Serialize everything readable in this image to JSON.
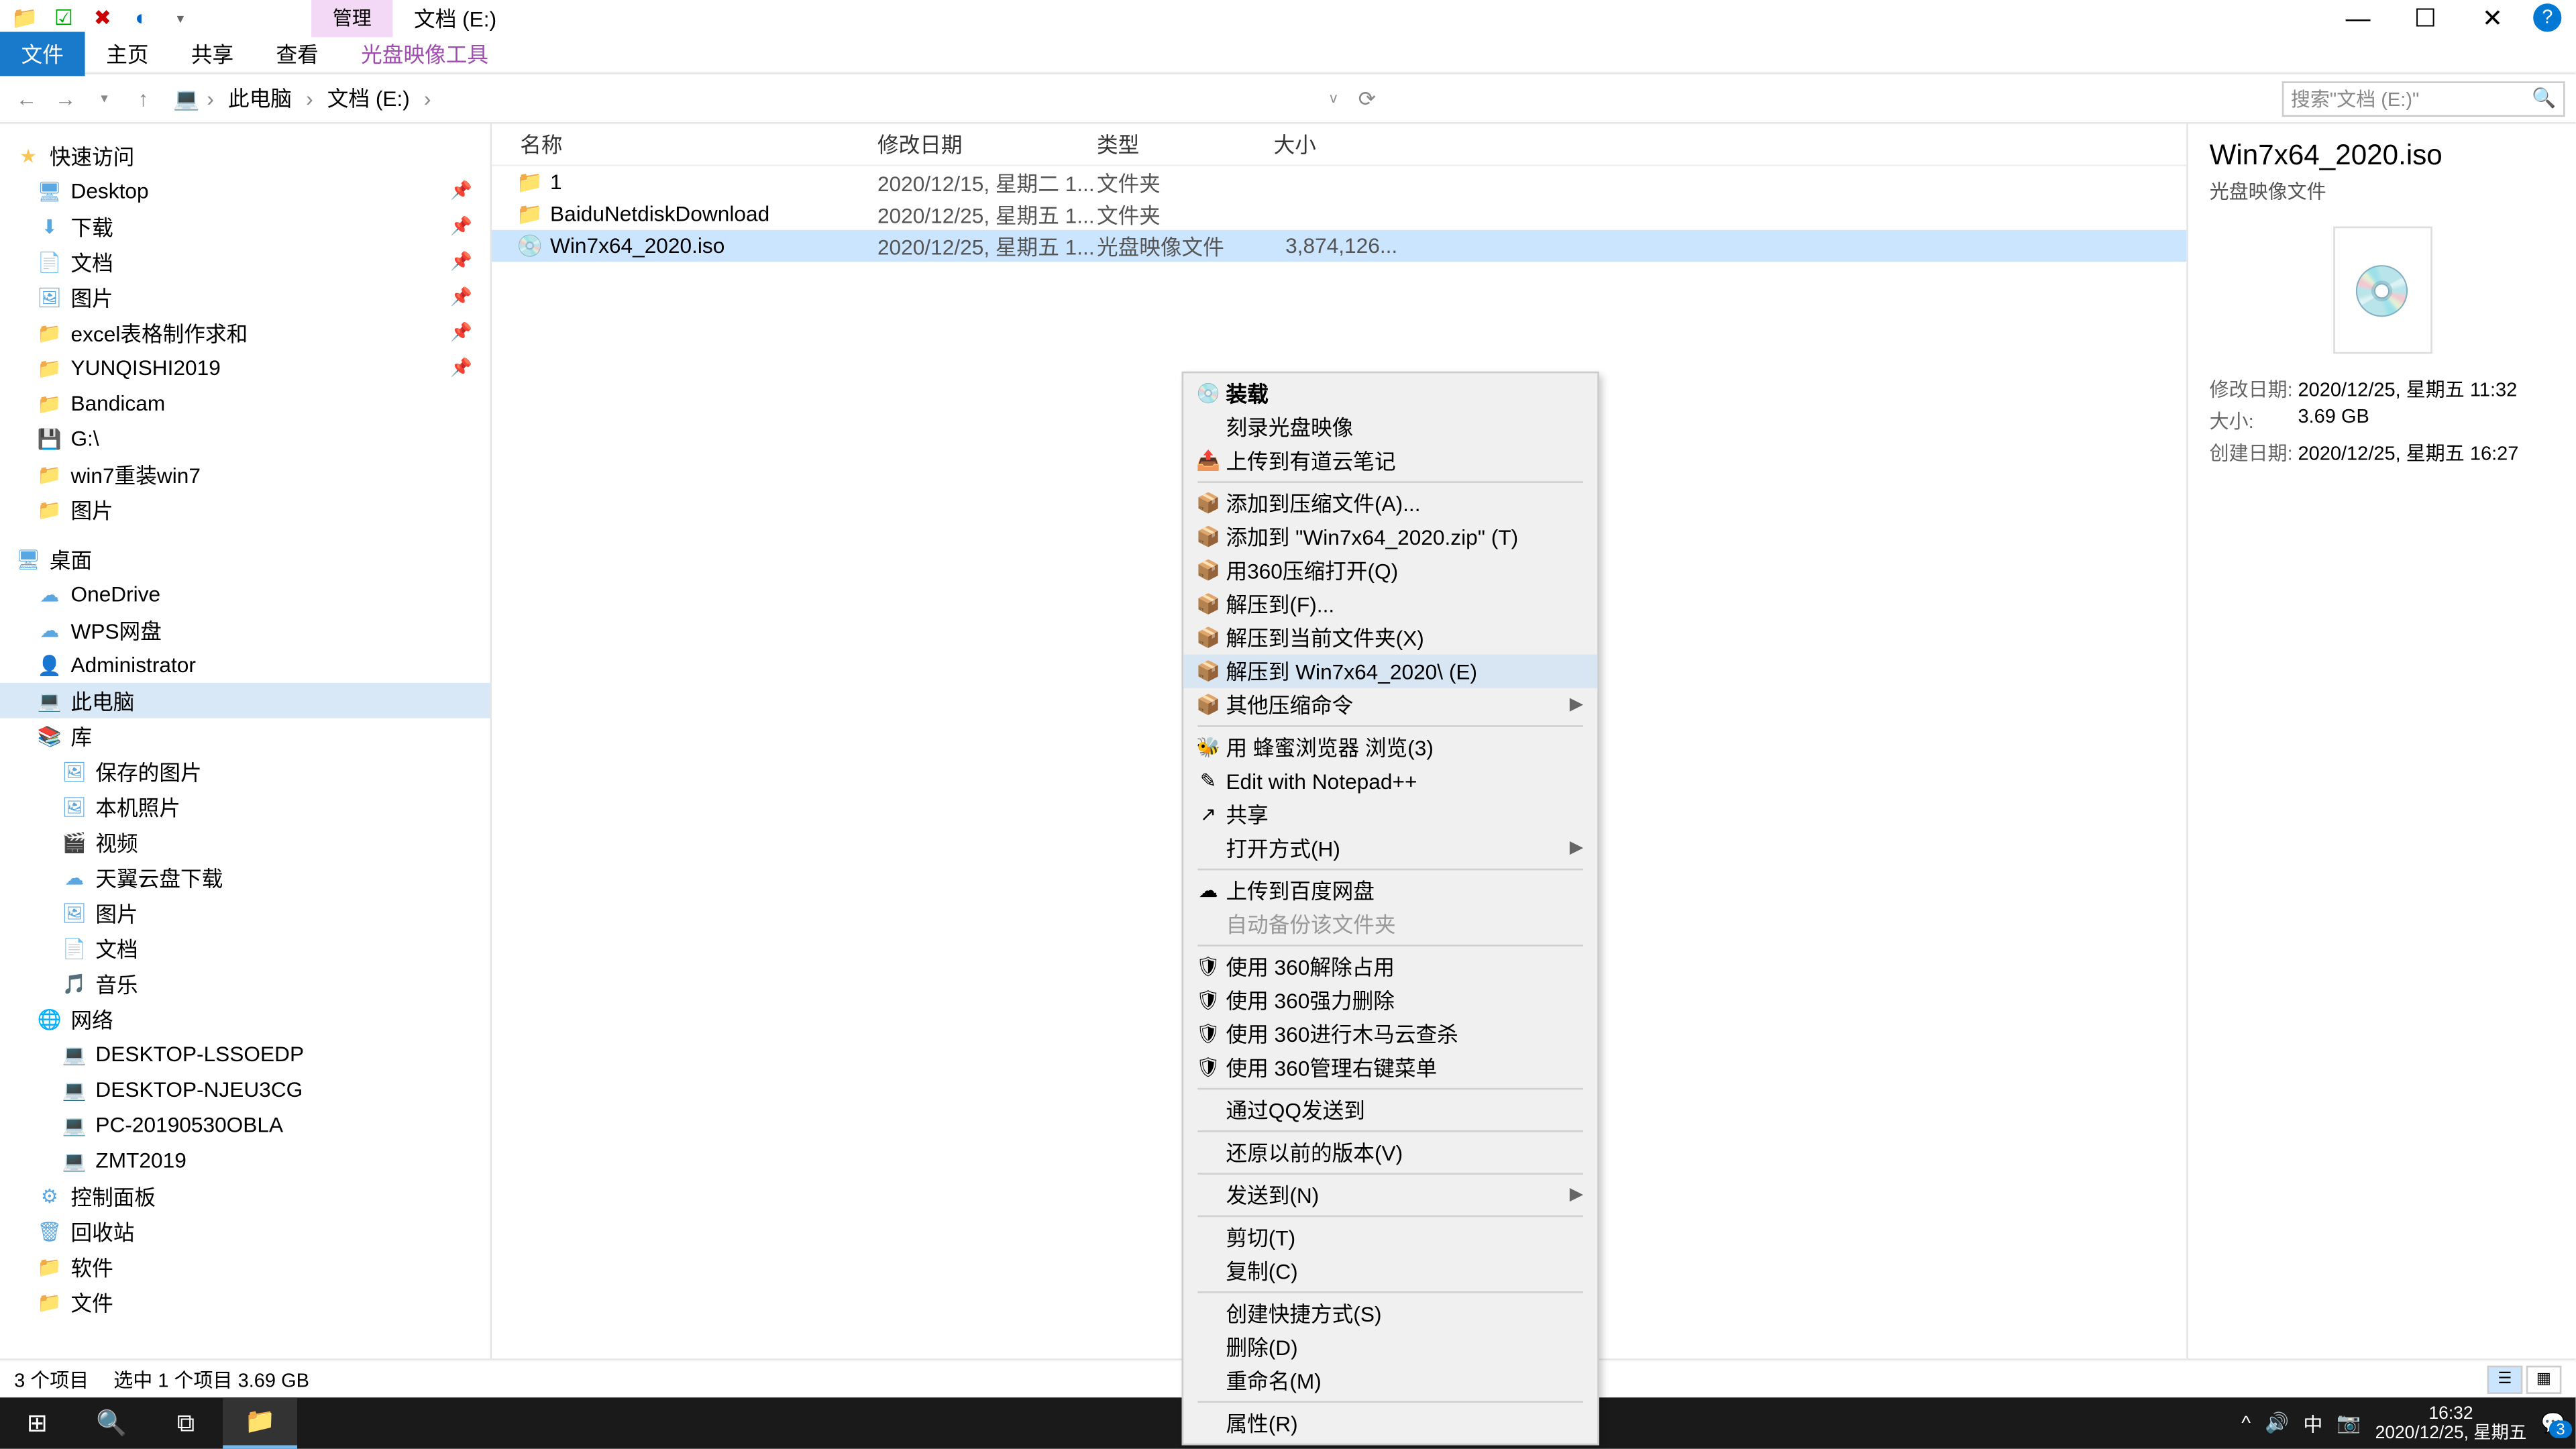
{
  "window": {
    "ctx_tab": "管理",
    "title": "文档 (E:)",
    "controls": {
      "min": "—",
      "max": "☐",
      "close": "✕",
      "help": "?"
    }
  },
  "ribbon": {
    "file": "文件",
    "tabs": [
      "主页",
      "共享",
      "查看"
    ],
    "ctx": "光盘映像工具"
  },
  "address": {
    "crumbs": [
      "此电脑",
      "文档 (E:)"
    ],
    "search_placeholder": "搜索\"文档 (E:)\""
  },
  "tree": {
    "quick": {
      "label": "快速访问",
      "items": [
        {
          "icon": "🖥",
          "label": "Desktop",
          "pin": true
        },
        {
          "icon": "⬇",
          "label": "下载",
          "pin": true
        },
        {
          "icon": "📄",
          "label": "文档",
          "pin": true
        },
        {
          "icon": "🖼",
          "label": "图片",
          "pin": true
        },
        {
          "icon": "📁",
          "label": "excel表格制作求和",
          "pin": true
        },
        {
          "icon": "📁",
          "label": "YUNQISHI2019",
          "pin": true
        },
        {
          "icon": "📁",
          "label": "Bandicam"
        },
        {
          "icon": "💾",
          "label": "G:\\"
        },
        {
          "icon": "📁",
          "label": "win7重装win7"
        },
        {
          "icon": "📁",
          "label": "图片"
        }
      ]
    },
    "desktop": {
      "label": "桌面",
      "items": [
        {
          "icon": "☁",
          "label": "OneDrive"
        },
        {
          "icon": "☁",
          "label": "WPS网盘"
        },
        {
          "icon": "👤",
          "label": "Administrator"
        },
        {
          "icon": "💻",
          "label": "此电脑",
          "sel": true
        },
        {
          "icon": "📚",
          "label": "库"
        },
        {
          "icon": "🖼",
          "label": "保存的图片",
          "l": 2
        },
        {
          "icon": "🖼",
          "label": "本机照片",
          "l": 2
        },
        {
          "icon": "🎬",
          "label": "视频",
          "l": 2
        },
        {
          "icon": "☁",
          "label": "天翼云盘下载",
          "l": 2
        },
        {
          "icon": "🖼",
          "label": "图片",
          "l": 2
        },
        {
          "icon": "📄",
          "label": "文档",
          "l": 2
        },
        {
          "icon": "🎵",
          "label": "音乐",
          "l": 2
        },
        {
          "icon": "🌐",
          "label": "网络"
        },
        {
          "icon": "💻",
          "label": "DESKTOP-LSSOEDP",
          "l": 2
        },
        {
          "icon": "💻",
          "label": "DESKTOP-NJEU3CG",
          "l": 2
        },
        {
          "icon": "💻",
          "label": "PC-20190530OBLA",
          "l": 2
        },
        {
          "icon": "💻",
          "label": "ZMT2019",
          "l": 2
        },
        {
          "icon": "⚙",
          "label": "控制面板"
        },
        {
          "icon": "🗑",
          "label": "回收站"
        },
        {
          "icon": "📁",
          "label": "软件"
        },
        {
          "icon": "📁",
          "label": "文件"
        }
      ]
    }
  },
  "columns": {
    "name": "名称",
    "date": "修改日期",
    "type": "类型",
    "size": "大小"
  },
  "rows": [
    {
      "icon": "📁",
      "name": "1",
      "date": "2020/12/15, 星期二 1...",
      "type": "文件夹",
      "size": ""
    },
    {
      "icon": "📁",
      "name": "BaiduNetdiskDownload",
      "date": "2020/12/25, 星期五 1...",
      "type": "文件夹",
      "size": ""
    },
    {
      "icon": "💿",
      "name": "Win7x64_2020.iso",
      "date": "2020/12/25, 星期五 1...",
      "type": "光盘映像文件",
      "size": "3,874,126...",
      "sel": true
    }
  ],
  "details": {
    "title": "Win7x64_2020.iso",
    "subtitle": "光盘映像文件",
    "props": [
      {
        "k": "修改日期:",
        "v": "2020/12/25, 星期五 11:32"
      },
      {
        "k": "大小:",
        "v": "3.69 GB"
      },
      {
        "k": "创建日期:",
        "v": "2020/12/25, 星期五 16:27"
      }
    ]
  },
  "menu": [
    {
      "icon": "💿",
      "label": "装载",
      "bold": true
    },
    {
      "label": "刻录光盘映像"
    },
    {
      "icon": "📤",
      "label": "上传到有道云笔记"
    },
    {
      "sep": true
    },
    {
      "icon": "📦",
      "label": "添加到压缩文件(A)..."
    },
    {
      "icon": "📦",
      "label": "添加到 \"Win7x64_2020.zip\" (T)"
    },
    {
      "icon": "📦",
      "label": "用360压缩打开(Q)"
    },
    {
      "icon": "📦",
      "label": "解压到(F)..."
    },
    {
      "icon": "📦",
      "label": "解压到当前文件夹(X)"
    },
    {
      "icon": "📦",
      "label": "解压到 Win7x64_2020\\ (E)",
      "hov": true
    },
    {
      "icon": "📦",
      "label": "其他压缩命令",
      "arrow": true
    },
    {
      "sep": true
    },
    {
      "icon": "🐝",
      "label": "用 蜂蜜浏览器 浏览(3)"
    },
    {
      "icon": "✎",
      "label": "Edit with Notepad++"
    },
    {
      "icon": "↗",
      "label": "共享"
    },
    {
      "label": "打开方式(H)",
      "arrow": true
    },
    {
      "sep": true
    },
    {
      "icon": "☁",
      "label": "上传到百度网盘"
    },
    {
      "label": "自动备份该文件夹",
      "dis": true
    },
    {
      "sep": true
    },
    {
      "icon": "🛡",
      "label": "使用 360解除占用"
    },
    {
      "icon": "🛡",
      "label": "使用 360强力删除"
    },
    {
      "icon": "🛡",
      "label": "使用 360进行木马云查杀"
    },
    {
      "icon": "🛡",
      "label": "使用 360管理右键菜单"
    },
    {
      "sep": true
    },
    {
      "label": "通过QQ发送到"
    },
    {
      "sep": true
    },
    {
      "label": "还原以前的版本(V)"
    },
    {
      "sep": true
    },
    {
      "label": "发送到(N)",
      "arrow": true
    },
    {
      "sep": true
    },
    {
      "label": "剪切(T)"
    },
    {
      "label": "复制(C)"
    },
    {
      "sep": true
    },
    {
      "label": "创建快捷方式(S)"
    },
    {
      "label": "删除(D)"
    },
    {
      "label": "重命名(M)"
    },
    {
      "sep": true
    },
    {
      "label": "属性(R)"
    }
  ],
  "status": {
    "count": "3 个项目",
    "sel": "选中 1 个项目  3.69 GB"
  },
  "taskbar": {
    "time": "16:32",
    "date": "2020/12/25, 星期五",
    "ime": "中",
    "badge": "3"
  }
}
